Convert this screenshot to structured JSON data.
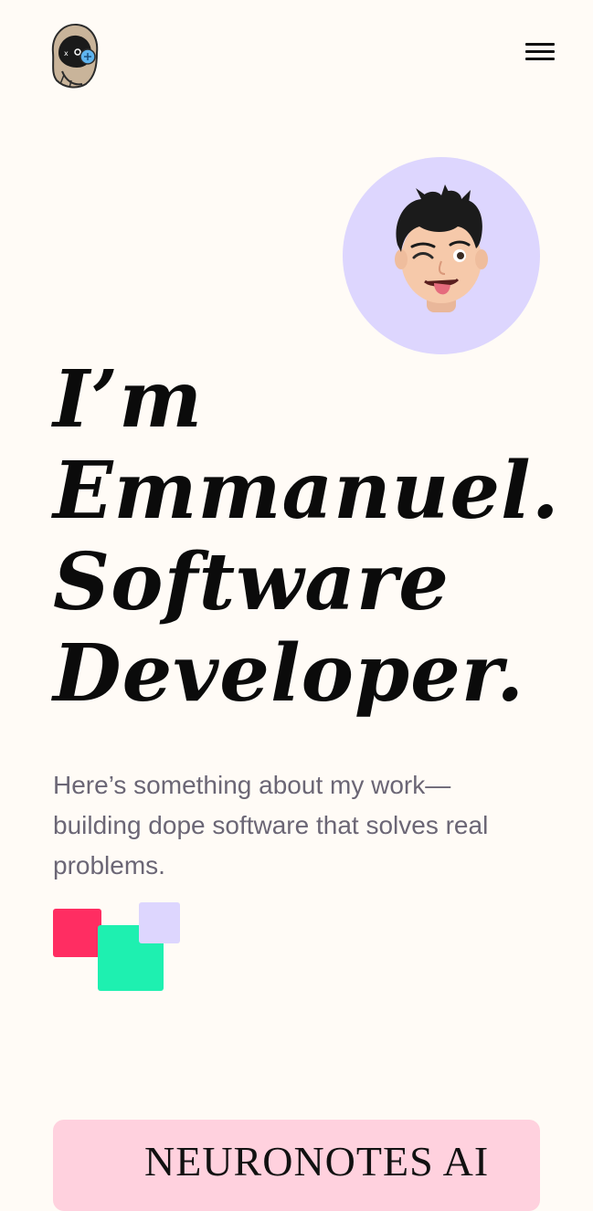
{
  "header": {
    "logo_icon": "hooded-gamer-mascot-icon",
    "menu_icon": "hamburger-menu-icon"
  },
  "hero": {
    "avatar_icon": "winking-memoji-avatar-icon",
    "headline_lines": [
      "I’m",
      "Emmanuel.",
      "Software",
      "Developer."
    ],
    "intro": "Here’s something about my work—building dope software that solves real problems."
  },
  "decor": {
    "colors": {
      "red": "#ff2d62",
      "green": "#1ef0b0",
      "lavender": "#ddd6fe"
    }
  },
  "projects": [
    {
      "title": "NEURONOTES AI",
      "card_color": "#ffd1de"
    }
  ]
}
